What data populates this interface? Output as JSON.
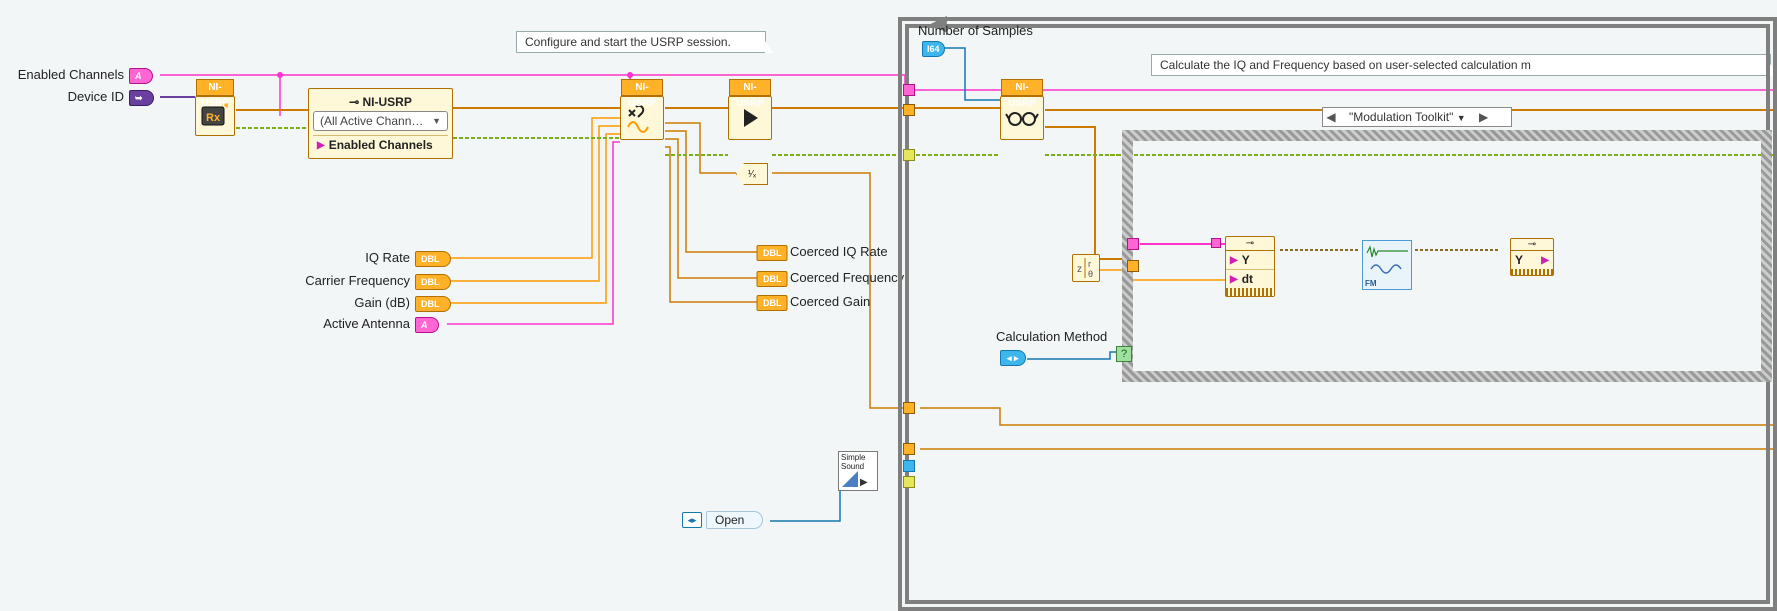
{
  "comments": {
    "configure": "Configure and start the USRP session.",
    "calculate": "Calculate the IQ and Frequency based on user-selected calculation m"
  },
  "labels": {
    "enabled_channels": "Enabled Channels",
    "device_id": "Device ID",
    "iq_rate": "IQ Rate",
    "carrier_freq": "Carrier Frequency",
    "gain": "Gain (dB)",
    "active_antenna": "Active Antenna",
    "num_samples": "Number of Samples",
    "coerced_iq": "Coerced IQ Rate",
    "coerced_freq": "Coerced Frequency",
    "coerced_gain": "Coerced Gain",
    "calc_method": "Calculation Method"
  },
  "tags": {
    "dbl": "DBL",
    "string": "A",
    "i64": "I64",
    "ref": "➥",
    "enum_sym": "◂ ▸"
  },
  "vis": {
    "usrp": "NI-USRP",
    "usrp_title": "⊸  NI-USRP",
    "active_channels": "(All Active Chann…",
    "enabled_ch_prop": "Enabled Channels",
    "modulation_case": "\"Modulation Toolkit\"",
    "y": "Y",
    "dt": "dt",
    "z": "z",
    "r": "r",
    "theta": "θ",
    "fm": "FM",
    "simple_sound": "Simple Sound",
    "open": "Open",
    "reciprocal": "¹⁄ₓ",
    "y2": "Y"
  }
}
